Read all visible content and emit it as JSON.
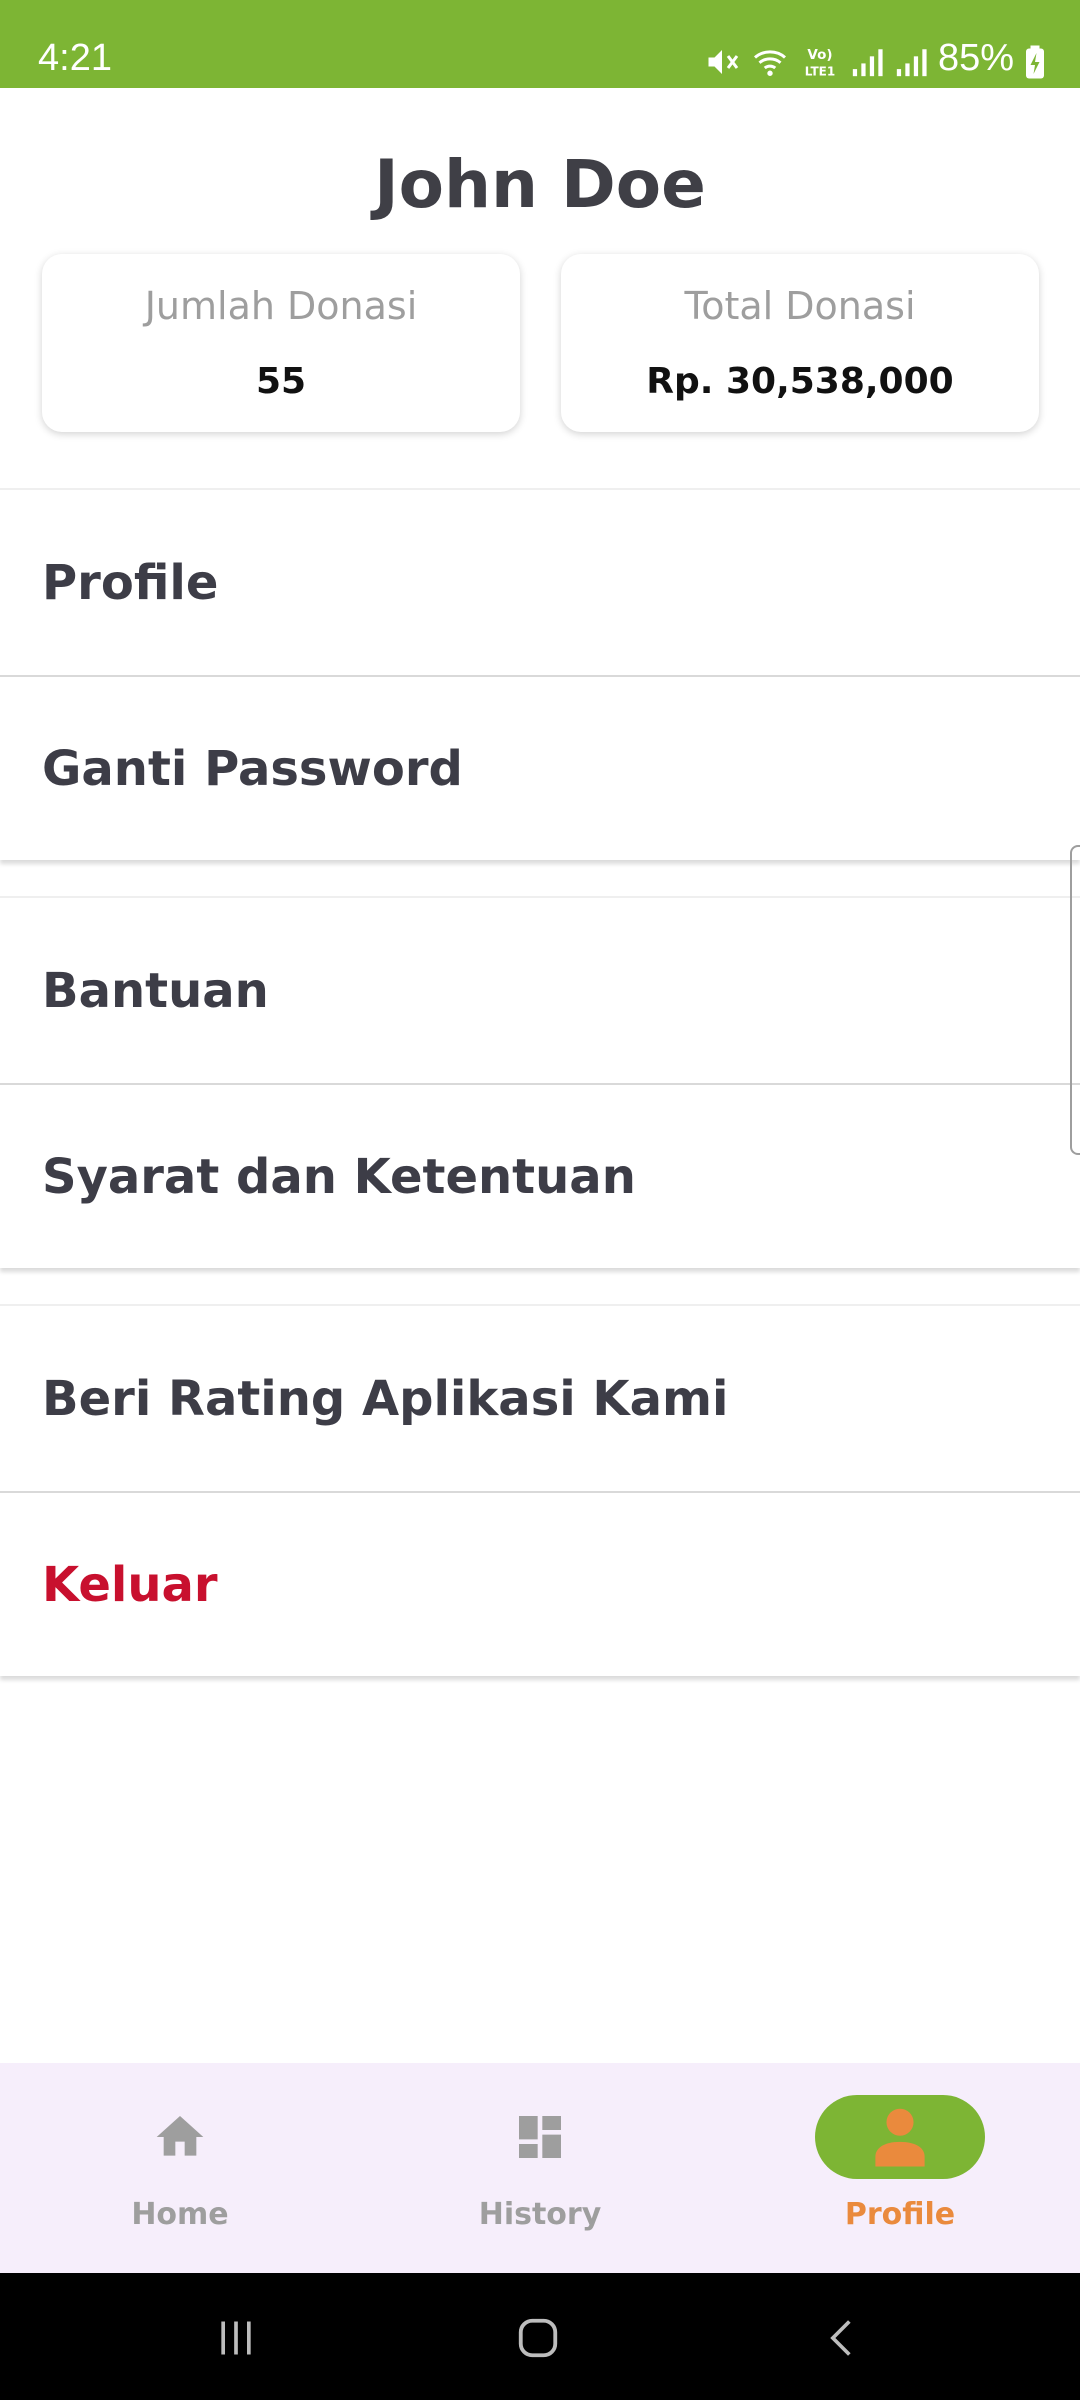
{
  "status_bar": {
    "time": "4:21",
    "battery_percent": "85%",
    "icons": [
      "mute-icon",
      "wifi-icon",
      "volte-icon",
      "signal-icon",
      "signal-icon",
      "battery-charging-icon"
    ]
  },
  "profile": {
    "name": "John Doe"
  },
  "stats": {
    "donation_count_label": "Jumlah Donasi",
    "donation_count_value": "55",
    "donation_total_label": "Total Donasi",
    "donation_total_value": "Rp. 30,538,000"
  },
  "menu": {
    "profile": "Profile",
    "change_password": "Ganti Password",
    "help": "Bantuan",
    "terms": "Syarat dan Ketentuan",
    "rate_app": "Beri Rating Aplikasi Kami",
    "logout": "Keluar"
  },
  "bottom_nav": {
    "home": "Home",
    "history": "History",
    "profile": "Profile",
    "active": "profile"
  },
  "colors": {
    "brand_green": "#7db534",
    "active_orange": "#ea8a3d",
    "logout_red": "#c8102e",
    "nav_background": "#f6eefb"
  }
}
